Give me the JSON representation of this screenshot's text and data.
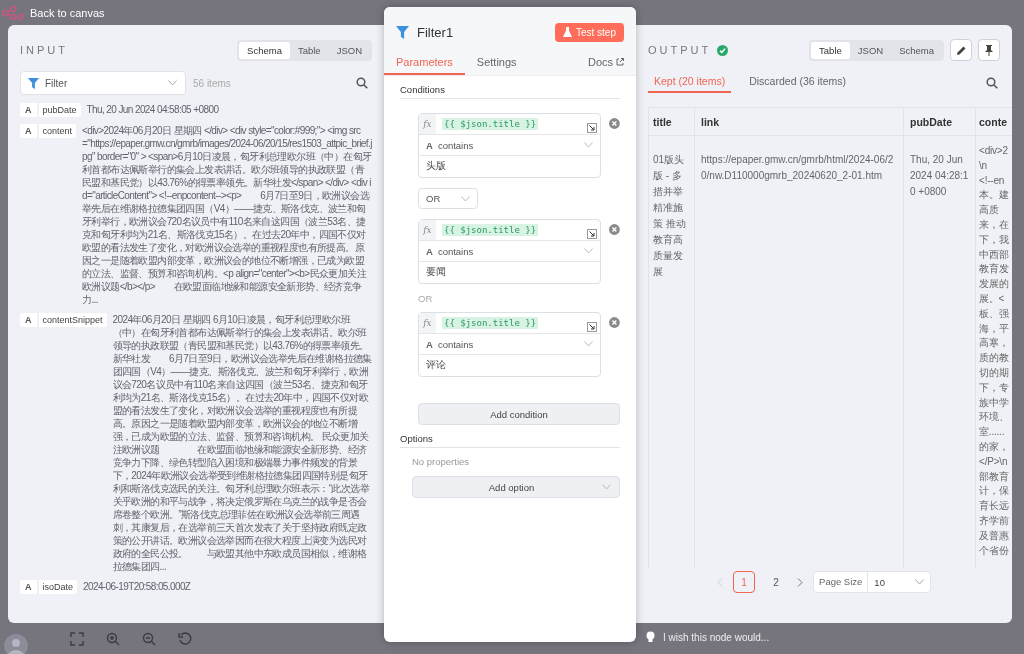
{
  "top_bar": {
    "back_link": "Back to canvas"
  },
  "input_panel": {
    "title": "INPUT",
    "view_tabs": [
      {
        "label": "Schema",
        "selected": true
      },
      {
        "label": "Table",
        "selected": false
      },
      {
        "label": "JSON",
        "selected": false
      }
    ],
    "filter": {
      "placeholder": "Filter"
    },
    "item_count": "56 items",
    "fields": [
      {
        "type": "A",
        "name": "pubDate",
        "value": "Thu, 20 Jun 2024 04:58:05 +0800"
      },
      {
        "type": "A",
        "name": "content",
        "value": "<div>2024年06月20日 星期四 </div> <div style=\"color:#999;\"> <img src=\"https://epaper.gmw.cn/gmrb/images/2024-06/20/15/res1503_attpic_brief.jpg\" border=\"0\" > <span>6月10日凌晨，匈牙利总理欧尔班（中）在匈牙利首都布达佩斯举行的集会上发表讲话。欧尔班领导的执政联盟（青民盟和基民党）以43.76%的得票率领先。新华社发</span> </div> <div id=\"articleContent\"> <!--enpcontent--><p>　　6月7日至9日，欧洲议会选举先后在维谢格拉德集团四国（V4）——捷克、斯洛伐克、波兰和匈牙利举行，欧洲议会720名议员中有110名来自这四国（波兰53名、捷克和匈牙利均为21名、斯洛伐克15名）。在过去20年中，四国不仅对欧盟的看法发生了变化，对欧洲议会选举的重视程度也有所提高。原因之一是随着欧盟内部变革，欧洲议会的地位不断增强，已成为欧盟的立法、监督、预算和咨询机构。<p align=\"center\"><b>民众更加关注欧洲议题</b></p>　　在欧盟面临地缘和能源安全新形势、经济竞争力..."
      },
      {
        "type": "A",
        "name": "contentSnippet",
        "value": "2024年06月20日 星期四 6月10日凌晨，匈牙利总理欧尔班（中）在匈牙利首都布达佩斯举行的集会上发表讲话。欧尔班领导的执政联盟（青民盟和基民党）以43.76%的得票率领先。新华社发　　6月7日至9日，欧洲议会选举先后在维谢格拉德集团四国（V4）——捷克、斯洛伐克、波兰和匈牙利举行，欧洲议会720名议员中有110名来自这四国（波兰53名、捷克和匈牙利均为21名、斯洛伐克15名）。在过去20年中，四国不仅对欧盟的看法发生了变化，对欧洲议会选举的重视程度也有所提高。原因之一是随着欧盟内部变革，欧洲议会的地位不断增强，已成为欧盟的立法、监督、预算和咨询机构。 民众更加关注欧洲议题　　　　在欧盟面临地缘和能源安全新形势、经济竞争力下降、绿色转型陷入困境和极端暴力事件频发的背景下，2024年欧洲议会选举受到维谢格拉德集团四国特别是匈牙利和斯洛伐克选民的关注。匈牙利总理欧尔班表示：“此次选举关乎欧洲的和平与战争，将决定俄罗斯在乌克兰的战争是否会席卷整个欧洲。”斯洛伐克总理菲佐在欧洲议会选举前三周遇刺，其康复后，在选举前三天首次发表了关于坚持政府既定政策的公开讲话。欧洲议会选举因而在很大程度上演变为选民对政府的全民公投。　　与欧盟其他中东欧成员国相似，维谢格拉德集团四..."
      },
      {
        "type": "A",
        "name": "isoDate",
        "value": "2024-06-19T20:58:05.000Z"
      }
    ]
  },
  "node_panel": {
    "title": "Filter1",
    "test_button": "Test step",
    "tabs": [
      {
        "label": "Parameters",
        "selected": true
      },
      {
        "label": "Settings",
        "selected": false
      }
    ],
    "docs_link": "Docs",
    "conditions_heading": "Conditions",
    "conditions": [
      {
        "expression_label": "fx",
        "expression": "{{ $json.title }}",
        "type": "A",
        "operator": "contains",
        "value": "头版"
      },
      {
        "expression_label": "fx",
        "expression": "{{ $json.title }}",
        "type": "A",
        "operator": "contains",
        "value": "要闻"
      },
      {
        "expression_label": "fx",
        "expression": "{{ $json.title }}",
        "type": "A",
        "operator": "contains",
        "value": "评论"
      }
    ],
    "combinators": [
      {
        "kind": "select",
        "label": "OR"
      },
      {
        "kind": "text",
        "label": "OR"
      }
    ],
    "add_condition": "Add condition",
    "options_heading": "Options",
    "options_empty": "No properties",
    "add_option": "Add option"
  },
  "output_panel": {
    "title": "OUTPUT",
    "success": true,
    "view_tabs": [
      {
        "label": "Table",
        "selected": true
      },
      {
        "label": "JSON",
        "selected": false
      },
      {
        "label": "Schema",
        "selected": false
      }
    ],
    "result_tabs": [
      {
        "label": "Kept (20 items)",
        "selected": true
      },
      {
        "label": "Discarded (36 items)",
        "selected": false
      }
    ],
    "table": {
      "columns": [
        "title",
        "link",
        "pubDate",
        "conte"
      ],
      "rows": [
        {
          "title": "01版头版 - 多措并举精准施策 推动教育高质量发展",
          "link": "https://epaper.gmw.cn/gmrb/html/2024-06/20/nw.D110000gmrb_20240620_2-01.htm",
          "pubDate": "Thu, 20 Jun 2024 04:28:10 +0800",
          "content_lines": [
            "<div>2",
            "\\n",
            "<!--en",
            "本。建",
            "高质",
            "来，在",
            "下，我",
            "中西部",
            "教育发",
            "发展的",
            "展。<",
            "板、强",
            "海，平",
            "高寒，",
            "质的教",
            "切的期",
            "下，专",
            "族中学",
            "环境、",
            "室......",
            "的家，",
            "</P>\\n",
            "部教育",
            "计，保",
            "育长远",
            "齐学前",
            "及普惠",
            "个省份"
          ]
        }
      ]
    },
    "pagination": {
      "pages": [
        {
          "label": "1",
          "selected": true
        },
        {
          "label": "2",
          "selected": false
        }
      ],
      "page_size_label": "Page Size",
      "page_size": "10"
    }
  },
  "feedback": {
    "text": "I wish this node would..."
  }
}
